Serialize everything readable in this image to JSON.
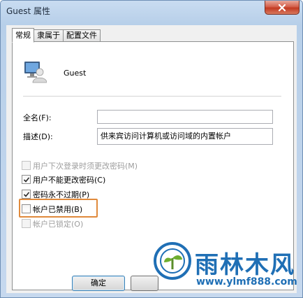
{
  "window": {
    "title": "Guest 属性"
  },
  "tabs": [
    {
      "label": "常规",
      "active": true
    },
    {
      "label": "隶属于",
      "active": false
    },
    {
      "label": "配置文件",
      "active": false
    }
  ],
  "general": {
    "username": "Guest",
    "fullname_label": "全名(F):",
    "fullname_value": "",
    "description_label": "描述(D):",
    "description_value": "供来宾访问计算机或访问域的内置帐户"
  },
  "options": [
    {
      "label": "用户下次登录时须更改密码(M)",
      "checked": false,
      "enabled": false
    },
    {
      "label": "用户不能更改密码(C)",
      "checked": true,
      "enabled": true
    },
    {
      "label": "密码永不过期(P)",
      "checked": true,
      "enabled": true
    },
    {
      "label": "帐户已禁用(B)",
      "checked": false,
      "enabled": true
    },
    {
      "label": "帐户已锁定(O)",
      "checked": false,
      "enabled": false
    }
  ],
  "buttons": {
    "ok": "确定",
    "cancel": "取消"
  },
  "watermark": {
    "brand": "雨林木风",
    "url": "www.ylmf888.com"
  },
  "colors": {
    "highlight": "#e08a3c",
    "watermark": "#1f6fb5"
  }
}
